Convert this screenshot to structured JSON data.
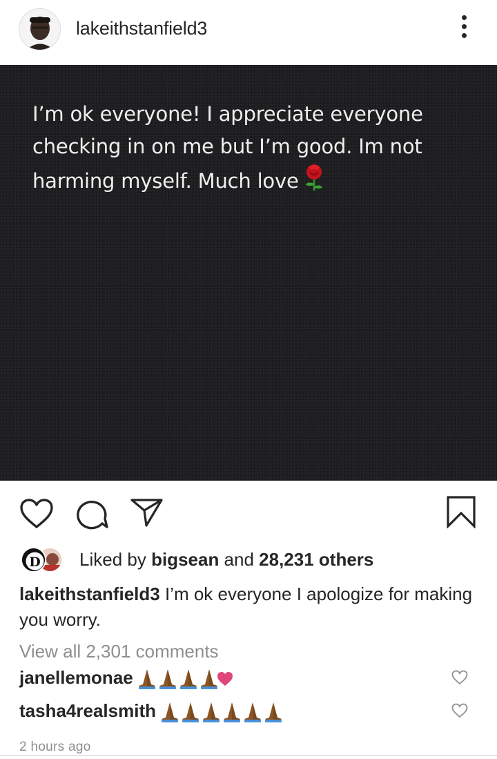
{
  "header": {
    "username": "lakeithstanfield3"
  },
  "post": {
    "image_text_line1": "I’m ok everyone! I appreciate everyone",
    "image_text_line2": "checking in on me but I’m good. Im not",
    "image_text_line3": "harming myself. Much love"
  },
  "likes": {
    "prefix": "Liked by ",
    "user": "bigsean",
    "middle": " and ",
    "count": "28,231 others"
  },
  "caption": {
    "username": "lakeithstanfield3",
    "text": " I’m ok everyone I apologize for making you worry."
  },
  "view_all_comments": "View all 2,301 comments",
  "comments": [
    {
      "username": "janellemonae",
      "emoji": [
        "folded-hands-icon",
        "folded-hands-icon",
        "folded-hands-icon",
        "folded-hands-icon",
        "pink-heart-icon"
      ]
    },
    {
      "username": "tasha4realsmith",
      "emoji": [
        "folded-hands-icon",
        "folded-hands-icon",
        "folded-hands-icon",
        "folded-hands-icon",
        "folded-hands-icon",
        "folded-hands-icon"
      ]
    }
  ],
  "timestamp": "2 hours ago",
  "colors": {
    "text": "#262626",
    "secondary": "#8e8e8e",
    "image_bg": "#1f1f21",
    "heart_pink": "#e0457b"
  }
}
